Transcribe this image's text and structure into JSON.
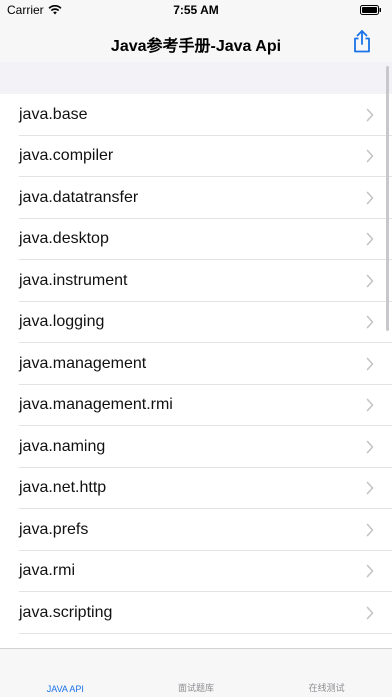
{
  "status": {
    "carrier": "Carrier",
    "time": "7:55 AM"
  },
  "nav": {
    "title": "Java参考手册-Java Api",
    "action_icon": "share-icon"
  },
  "modules": [
    {
      "label": "java.base"
    },
    {
      "label": "java.compiler"
    },
    {
      "label": "java.datatransfer"
    },
    {
      "label": "java.desktop"
    },
    {
      "label": "java.instrument"
    },
    {
      "label": "java.logging"
    },
    {
      "label": "java.management"
    },
    {
      "label": "java.management.rmi"
    },
    {
      "label": "java.naming"
    },
    {
      "label": "java.net.http"
    },
    {
      "label": "java.prefs"
    },
    {
      "label": "java.rmi"
    },
    {
      "label": "java.scripting"
    }
  ],
  "tabs": [
    {
      "label": "JAVA API",
      "active": true
    },
    {
      "label": "面试题库",
      "active": false
    },
    {
      "label": "在线测试",
      "active": false
    }
  ],
  "colors": {
    "accent": "#1a73e8",
    "inactive": "#8e8e93"
  }
}
